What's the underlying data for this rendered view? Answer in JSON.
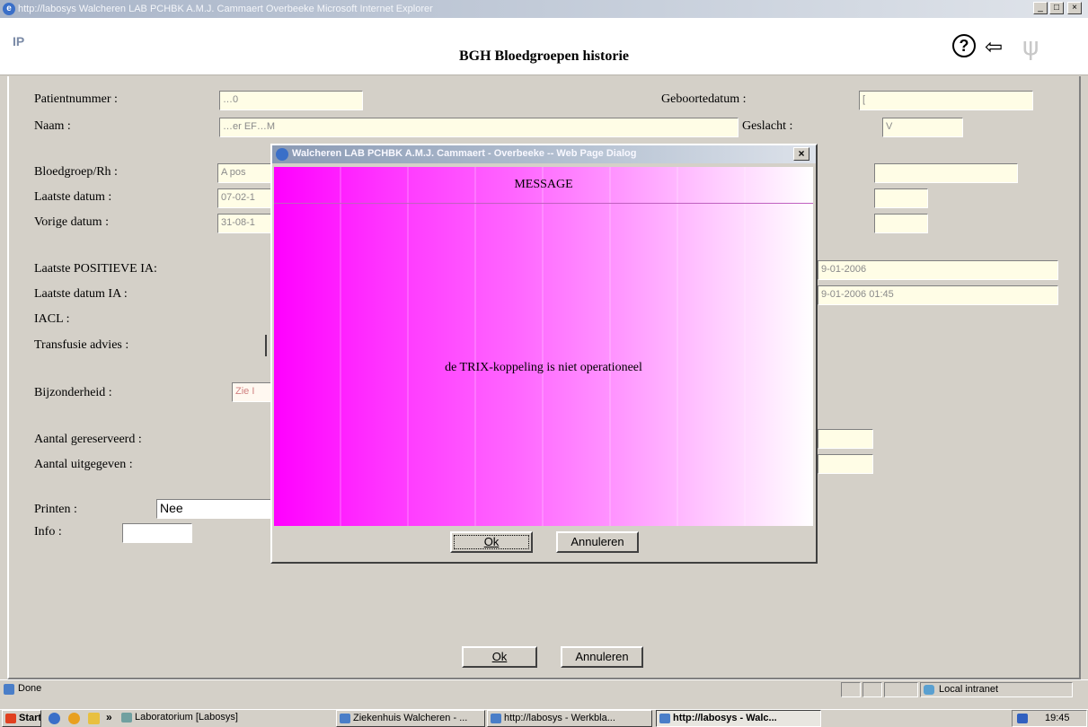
{
  "window": {
    "title": "http://labosys  Walcheren LAB PCHBK A.M.J. Cammaert  Overbeeke  Microsoft Internet Explorer",
    "controls": [
      "_",
      "□",
      "×"
    ]
  },
  "app": {
    "logo": "IP",
    "title": "BGH Bloedgroepen historie",
    "help_glyph": "?",
    "back_glyph": "⇦",
    "menu_glyph": "🍴"
  },
  "form": {
    "patientnummer": {
      "label": "Patientnummer :",
      "value": "…0"
    },
    "geboortedatum": {
      "label": "Geboortedatum :",
      "value": "["
    },
    "naam": {
      "label": "Naam :",
      "value": "…er  EF…M"
    },
    "geslacht": {
      "label": "Geslacht :",
      "value": "V"
    },
    "bloedgroep": {
      "label": "Bloedgroep/Rh :",
      "value": "A pos"
    },
    "laatste_datum": {
      "label": "Laatste datum :",
      "value": "07-02-1"
    },
    "vorige_datum": {
      "label": "Vorige datum :",
      "value": "31-08-1"
    },
    "laatste_positieve_ia": {
      "label": "Laatste POSITIEVE IA:",
      "value": "9-01-2006"
    },
    "laatste_datum_ia": {
      "label": "Laatste datum IA :",
      "value": "9-01-2006 01:45"
    },
    "iacl": {
      "label": "IACL :"
    },
    "transfusie_advies": {
      "label": "Transfusie advies :"
    },
    "bijzonderheid": {
      "label": "Bijzonderheid :",
      "value": "Zie I"
    },
    "aantal_gereserveerd": {
      "label": "Aantal gereserveerd :",
      "value": ""
    },
    "aantal_uitgegeven": {
      "label": "Aantal uitgegeven :",
      "value": ""
    },
    "printen": {
      "label": "Printen :",
      "value": "Nee"
    },
    "info": {
      "label": "Info :",
      "value": ""
    },
    "ok_label": "Ok",
    "cancel_label": "Annuleren"
  },
  "dialog": {
    "title": "Walcheren LAB PCHBK A.M.J. Cammaert - Overbeeke -- Web Page Dialog",
    "close_glyph": "×",
    "heading": "MESSAGE",
    "message": "de TRIX-koppeling is niet operationeel",
    "ok_label": "Ok",
    "cancel_label": "Annuleren"
  },
  "statusbar": {
    "status": "Done",
    "zone": "Local intranet"
  },
  "taskbar": {
    "start": "Start",
    "chevron": "»",
    "items": [
      "Laboratorium [Labosys]",
      "Ziekenhuis Walcheren - ...",
      "http://labosys - Werkbla...",
      "http://labosys - Walc..."
    ],
    "clock": "19:45"
  },
  "colors": {
    "dialog_gradient_start": "#ff00ff",
    "field_bg": "#fffde6",
    "chrome": "#d4d0c8"
  }
}
